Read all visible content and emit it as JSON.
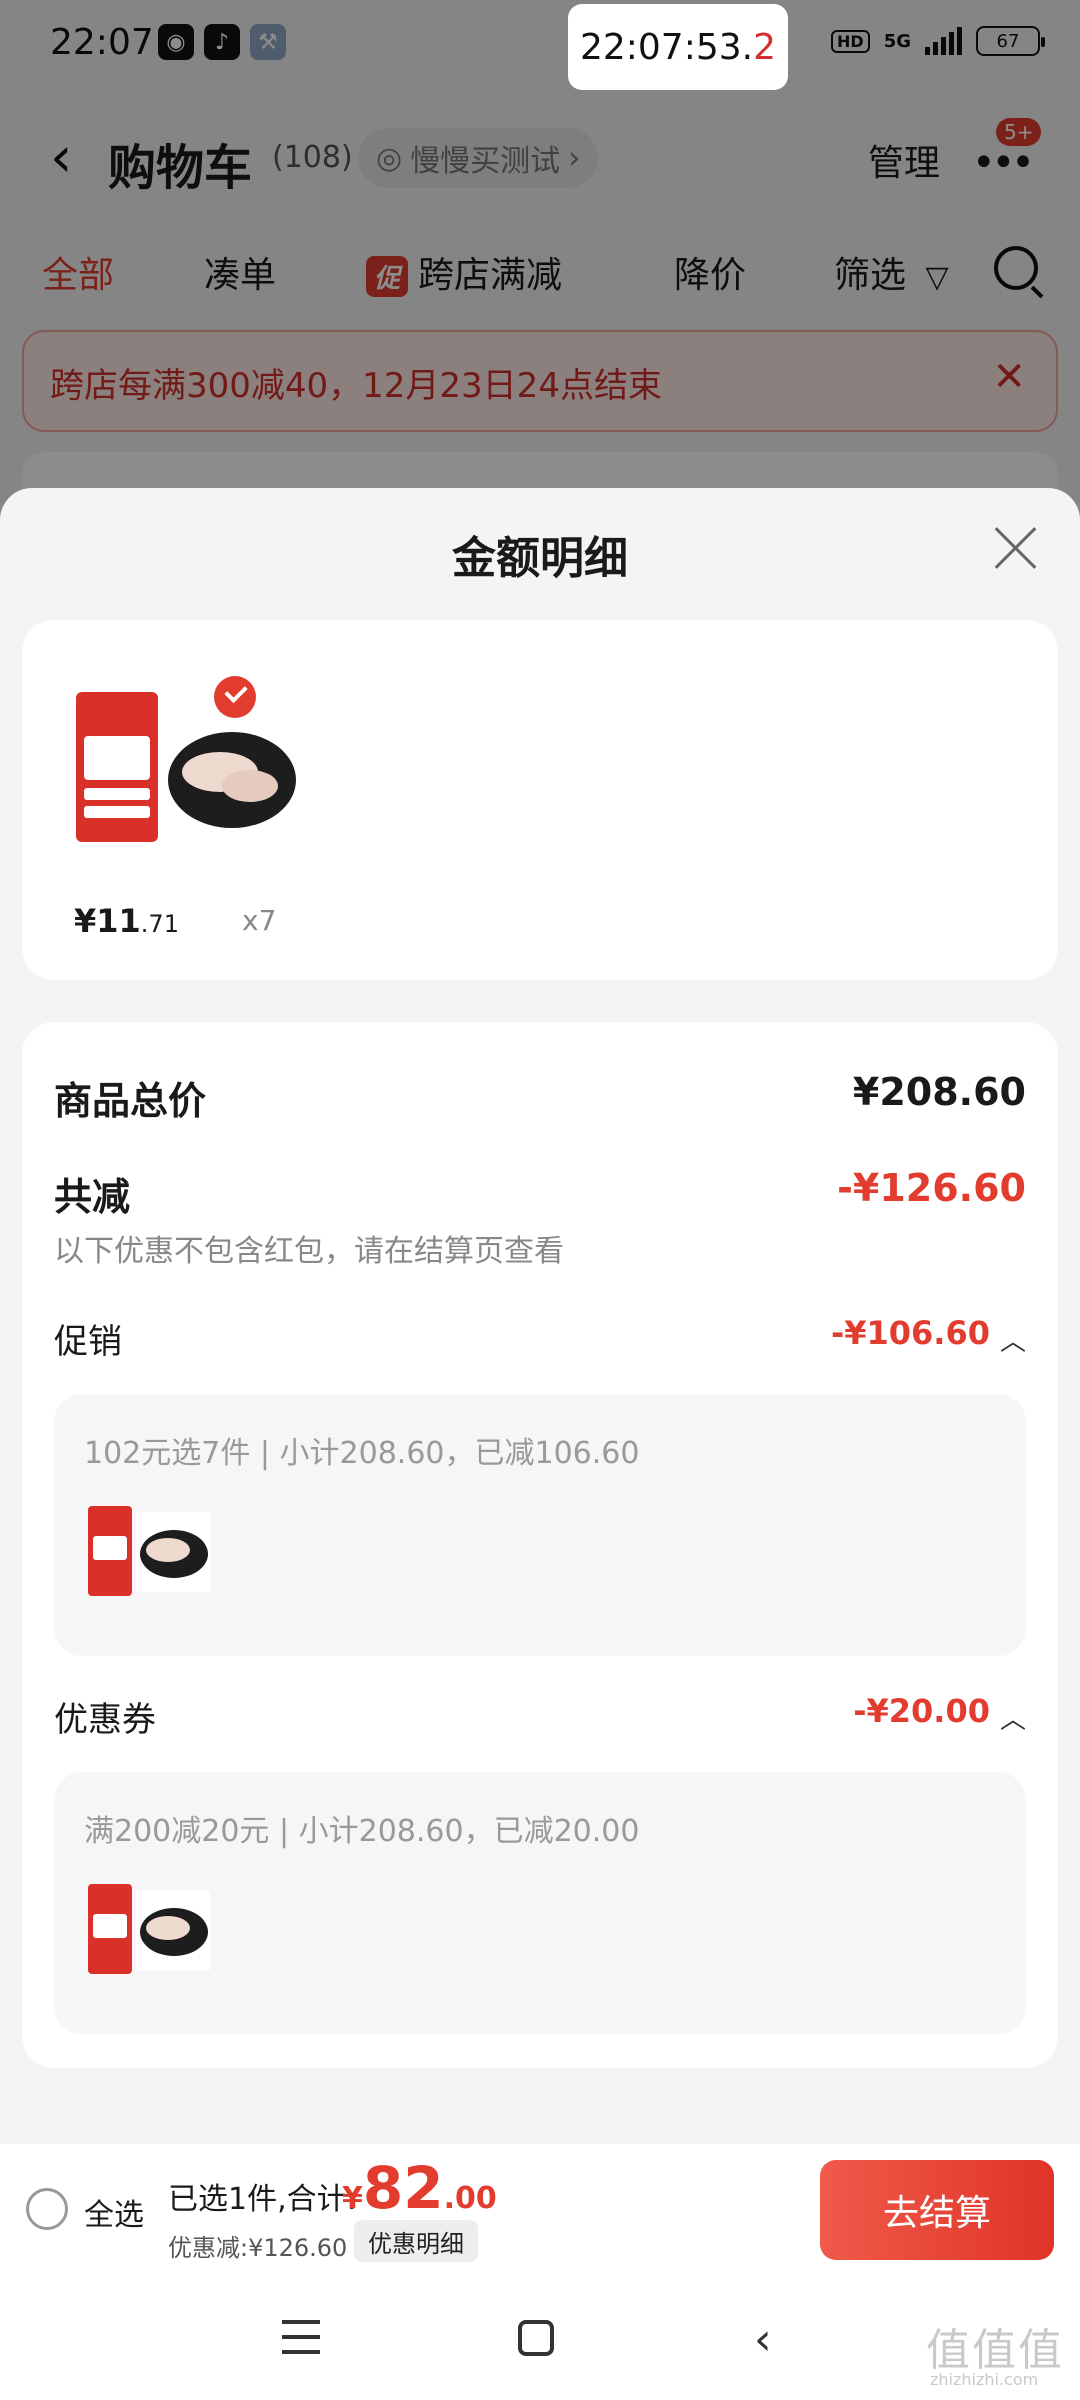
{
  "status_bar": {
    "time": "22:07",
    "timer_main": "22:07:53.",
    "timer_frac": "2",
    "hd": "HD",
    "network": "5G",
    "battery": "67"
  },
  "header": {
    "title": "购物车",
    "count": "(108)",
    "slow_test": "慢慢买测试",
    "manage": "管理",
    "badge": "5+"
  },
  "tabs": {
    "all": "全部",
    "combine": "凑单",
    "cu_badge": "促",
    "cross_store": "跨店满减",
    "price_drop": "降价",
    "filter": "筛选"
  },
  "promo_banner": {
    "text": "跨店每满300减40，12月23日24点结束"
  },
  "sheet": {
    "title": "金额明细",
    "item": {
      "price_main": "¥11",
      "price_frac": ".71",
      "qty": "x7"
    },
    "goods_total_label": "商品总价",
    "goods_total_value": "¥208.60",
    "total_off_label": "共减",
    "total_off_value": "-¥126.60",
    "note": "以下优惠不包含红包，请在结算页查看",
    "promo": {
      "label": "促销",
      "value": "-¥106.60",
      "detail": "102元选7件 | 小计208.60，已减106.60"
    },
    "coupon": {
      "label": "优惠券",
      "value": "-¥20.00",
      "detail": "满200减20元 | 小计208.60，已减20.00"
    }
  },
  "bottom_bar": {
    "select_all": "全选",
    "selected_sum": "已选1件,合计:",
    "total_currency": "¥",
    "total_int": "82",
    "total_dec": ".00",
    "discount_line": "优惠减:¥126.60",
    "discount_detail_btn": "优惠明细",
    "checkout": "去结算"
  },
  "watermark": {
    "main": "值值值",
    "sub": "zhizhizhi.com"
  },
  "colors": {
    "accent": "#e23c2f",
    "overlay": "rgba(0,0,0,0.45)"
  }
}
